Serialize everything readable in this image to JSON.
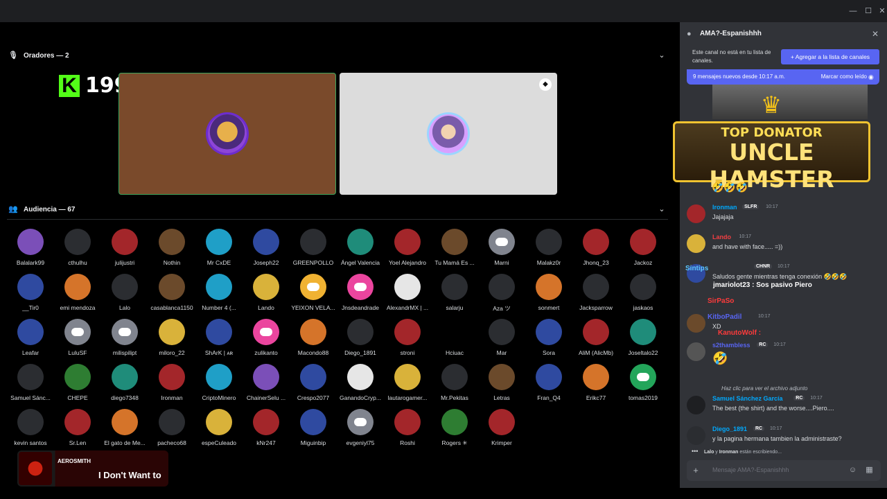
{
  "window": {
    "minimize": "—",
    "maximize": "☐",
    "close": "✕"
  },
  "speakers": {
    "label": "Oradores — 2",
    "chevron": "⌄",
    "mic_icon": "🎙"
  },
  "kick": {
    "logo_letter": "K",
    "viewer_count": "199"
  },
  "audience": {
    "label": "Audiencia — 67",
    "chevron": "⌄",
    "icon": "👥",
    "members": [
      {
        "name": "Balalark99",
        "style": "av-purple"
      },
      {
        "name": "cthulhu",
        "style": "av-dark"
      },
      {
        "name": "julijustri",
        "style": "av-red"
      },
      {
        "name": "Nothin",
        "style": "av-brown"
      },
      {
        "name": "Mr CxDE",
        "style": "av-cyan"
      },
      {
        "name": "Joseph22",
        "style": "av-blue"
      },
      {
        "name": "GREENPOLLO",
        "style": "av-dark"
      },
      {
        "name": "Ángel Valencia",
        "style": "av-teal"
      },
      {
        "name": "Yoel Alejandro",
        "style": "av-red"
      },
      {
        "name": "Tu Mamá Es ...",
        "style": "av-brown"
      },
      {
        "name": "Marni",
        "style": "disc"
      },
      {
        "name": "Malakz0r",
        "style": "av-dark"
      },
      {
        "name": "Jhonq_23",
        "style": "av-red"
      },
      {
        "name": "Jackoz",
        "style": "av-red"
      },
      {
        "name": "__Tir0",
        "style": "av-blue"
      },
      {
        "name": "emi mendoza",
        "style": "av-orange"
      },
      {
        "name": "Lalo",
        "style": "av-dark"
      },
      {
        "name": "casablanca1150",
        "style": "av-brown"
      },
      {
        "name": "Number 4 (...",
        "style": "av-cyan"
      },
      {
        "name": "Lando",
        "style": "av-yellow"
      },
      {
        "name": "YEIXON VELA...",
        "style": "orange"
      },
      {
        "name": "Jnsdeandrade",
        "style": "pink"
      },
      {
        "name": "AlexandrMX | ...",
        "style": "av-white"
      },
      {
        "name": "salarju",
        "style": "av-dark"
      },
      {
        "name": "Aza ツ",
        "style": "av-dark"
      },
      {
        "name": "sonmert",
        "style": "av-orange"
      },
      {
        "name": "Jacksparrow",
        "style": "av-dark"
      },
      {
        "name": "jaskaos",
        "style": "av-dark"
      },
      {
        "name": "Leafar",
        "style": "av-blue"
      },
      {
        "name": "LuluSF",
        "style": "disc"
      },
      {
        "name": "milispilipt",
        "style": "disc"
      },
      {
        "name": "miloro_22",
        "style": "av-yellow"
      },
      {
        "name": "ShArK | ᴀʀ",
        "style": "av-blue"
      },
      {
        "name": "zulikanto",
        "style": "pink"
      },
      {
        "name": "Macondo88",
        "style": "av-orange"
      },
      {
        "name": "Diego_1891",
        "style": "av-dark"
      },
      {
        "name": "stroni",
        "style": "av-red"
      },
      {
        "name": "Hciuac",
        "style": "av-none"
      },
      {
        "name": "Mar",
        "style": "av-dark"
      },
      {
        "name": "Sora",
        "style": "av-blue"
      },
      {
        "name": "AliM (AlicMb)",
        "style": "av-red"
      },
      {
        "name": "Joseltalo22",
        "style": "av-teal"
      },
      {
        "name": "Samuel Sánc...",
        "style": "av-dark"
      },
      {
        "name": "CHEPE",
        "style": "av-green"
      },
      {
        "name": "diego7348",
        "style": "av-teal"
      },
      {
        "name": "Ironman",
        "style": "av-red"
      },
      {
        "name": "CriptoMinero",
        "style": "av-cyan"
      },
      {
        "name": "ChainerSelu ...",
        "style": "av-purple"
      },
      {
        "name": "Crespo2077",
        "style": "av-blue"
      },
      {
        "name": "GanandoCryp...",
        "style": "av-white"
      },
      {
        "name": "lautarogamer...",
        "style": "av-yellow"
      },
      {
        "name": "Mr.Pekitas",
        "style": "av-dark"
      },
      {
        "name": "Letras",
        "style": "av-brown"
      },
      {
        "name": "Fran_Q4",
        "style": "av-blue"
      },
      {
        "name": "Erikc77",
        "style": "av-orange"
      },
      {
        "name": "tomas2019",
        "style": "green"
      },
      {
        "name": "kevin santos",
        "style": "av-dark"
      },
      {
        "name": "Sr.Len",
        "style": "av-red"
      },
      {
        "name": "El gato de Me...",
        "style": "av-orange"
      },
      {
        "name": "pacheco68",
        "style": "av-dark"
      },
      {
        "name": "espeCuleado",
        "style": "av-yellow"
      },
      {
        "name": "kNr247",
        "style": "av-red"
      },
      {
        "name": "Miguinbip",
        "style": "av-blue"
      },
      {
        "name": "evgeniyl75",
        "style": "disc"
      },
      {
        "name": "Roshi",
        "style": "av-red"
      },
      {
        "name": "Rogers ✳",
        "style": "av-green"
      },
      {
        "name": "Krimper",
        "style": "av-red"
      }
    ]
  },
  "now_playing": {
    "artist": "AEROSMITH",
    "song": "I Don't Want to"
  },
  "chat": {
    "title": "AMA?-Espanishhh",
    "thread_icon": "●",
    "close": "✕",
    "notice": "Este canal no está en tu lista de canales.",
    "add_button": "+ Agregar a la lista de canales",
    "new_messages": "9 mensajes nuevos desde 10:17 a.m.",
    "mark_read": "Marcar como leído",
    "mark_read_icon": "◉",
    "donor": {
      "top": "TOP DONATOR",
      "name": "UNCLE HAMSTER",
      "crown": "♛",
      "reactions": "🤣🤣🤣"
    },
    "messages": [
      {
        "user": "Ironman",
        "tag": "SLFR",
        "time": "10:17",
        "text": "Jajajaja",
        "color": "#00a8fc"
      },
      {
        "user": "Lando",
        "tag": "",
        "time": "10:17",
        "text": "and have with face..... =))",
        "color": "#f23f43"
      },
      {
        "user": "",
        "tag": "CHNR",
        "time": "10:17",
        "text": "Saludos gente mientras tenga conexión 🤣🤣🤣",
        "color": "#dbdee1"
      },
      {
        "user": "",
        "tag": "",
        "time": "10:17",
        "text": "XD",
        "color": "#00a8fc"
      },
      {
        "user": "s2thambless",
        "tag": "RC",
        "time": "10:17",
        "text": "🤣",
        "color": "#5865f2"
      },
      {
        "user": "Samuel Sánchez García",
        "tag": "RC",
        "time": "10:17",
        "text": "The best (the shirt) and the worse....Piero....",
        "color": "#00a8fc"
      },
      {
        "user": "Diego_1891",
        "tag": "RC",
        "time": "10:17",
        "text": "y la pagina hermana tambien la administraste?",
        "color": "#00a8fc"
      }
    ],
    "reply": "Haz clic para ver el archivo adjunto",
    "overlays": {
      "a": "Sintips",
      "b": "jmariolot23 : Sos pasivo Piero",
      "c": "SirPaSo",
      "d": "KitboPadil",
      "e": "KanutoWolf :"
    },
    "typing": {
      "who": "Lalo",
      "and": "y",
      "who2": "Ironman",
      "rest": "están escribiendo..."
    },
    "input_placeholder": "Mensaje AMA?-Espanishhh",
    "plus": "+",
    "emoji_icon": "☺",
    "apps_icon": "▦"
  },
  "colors": {
    "accent": "#5865f2",
    "speaking": "#3ba55c",
    "kick_green": "#53fc18"
  }
}
